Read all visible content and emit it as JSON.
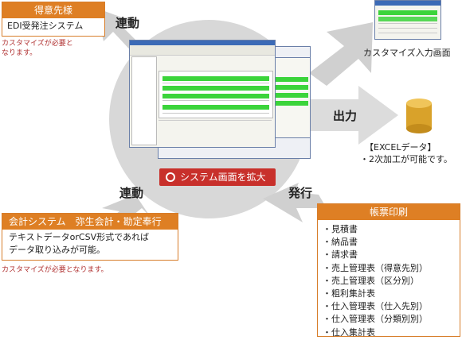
{
  "labels": {
    "rendo_top": "連動",
    "rendo_bottom": "連動",
    "output": "出力",
    "issue": "発行"
  },
  "customer": {
    "header": "得意先様",
    "system": "EDI受発注システム",
    "note_line1": "カスタマイズが必要と",
    "note_line2": "なります。"
  },
  "custom_screen": {
    "caption": "カスタマイズ入力画面"
  },
  "excel": {
    "line1": "【EXCELデータ】",
    "line2": "・2次加工が可能です。"
  },
  "enlarge_button": {
    "label": "システム画面を拡大"
  },
  "accounting": {
    "header": "会計システム　弥生会計・勘定奉行",
    "desc_line1": "テキストデータorCSV形式であれば",
    "desc_line2": "データ取り込みが可能。",
    "note": "カスタマイズが必要となります。"
  },
  "forms": {
    "header": "帳票印刷",
    "items": [
      "・見積書",
      "・納品書",
      "・請求書",
      "・売上管理表（得意先別）",
      "・売上管理表（区分別）",
      "・粗利集計表",
      "・仕入管理表（仕入先別）",
      "・仕入管理表（分類別別）",
      "・仕入集計表"
    ]
  },
  "colors": {
    "orange": "#de7f24",
    "red_button": "#c8302b",
    "circle_gray": "#d9d9d9",
    "cylinder": "#d9a22a",
    "note_red": "#b03030"
  }
}
